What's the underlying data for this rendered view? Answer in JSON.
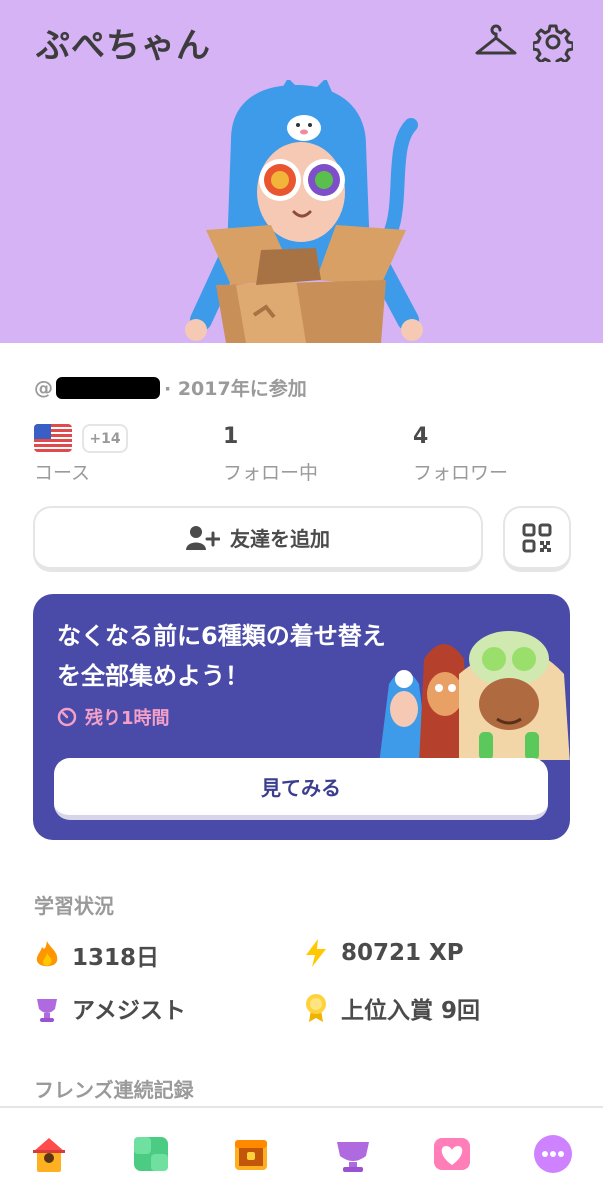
{
  "profile": {
    "username": "ぷぺちゃん",
    "handle_prefix": "@",
    "joined": "· 2017年に参加"
  },
  "stats": {
    "courses_extra": "+14",
    "courses_label": "コース",
    "following_count": "1",
    "following_label": "フォロー中",
    "followers_count": "4",
    "followers_label": "フォロワー"
  },
  "actions": {
    "add_friend": "友達を追加"
  },
  "promo": {
    "title": "なくなる前に6種類の着せ替えを全部集めよう！",
    "timer": "残り1時間",
    "button": "見てみる"
  },
  "learning": {
    "section_title": "学習状況",
    "streak": "1318日",
    "xp": "80721 XP",
    "league": "アメジスト",
    "top_finishes": "上位入賞 9回"
  },
  "friends_streak": {
    "section_title": "フレンズ連続記録"
  },
  "tabs": [
    "home-icon",
    "practice-icon",
    "chest-icon",
    "league-icon",
    "health-icon",
    "more-icon"
  ],
  "colors": {
    "hero_bg": "#d6b3f5",
    "promo_bg": "#4a4ba8",
    "accent_pink": "#f3a0c8"
  }
}
